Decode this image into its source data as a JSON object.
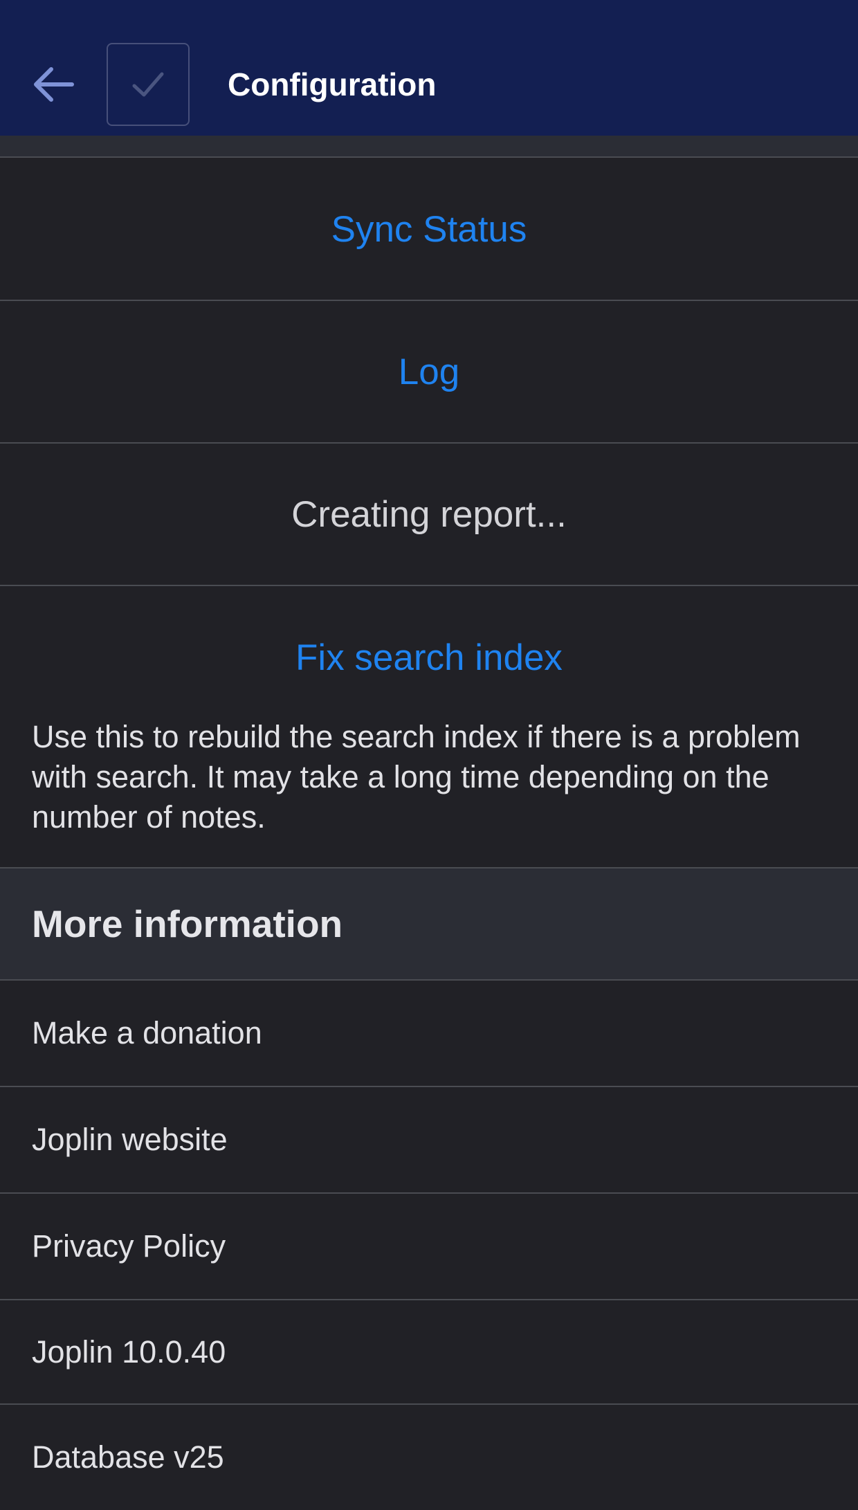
{
  "header": {
    "title": "Configuration",
    "back_icon": "arrow-left-icon",
    "save_icon": "checkmark-icon"
  },
  "advanced": {
    "sync_status_label": "Sync Status",
    "log_label": "Log",
    "report_label": "Creating report...",
    "fix_search_label": "Fix search index",
    "fix_search_description": "Use this to rebuild the search index if there is a problem with search. It may take a long time depending on the number of notes."
  },
  "more_information": {
    "title": "More information",
    "items": [
      {
        "label": "Make a donation"
      },
      {
        "label": "Joplin website"
      },
      {
        "label": "Privacy Policy"
      },
      {
        "label": "Joplin 10.0.40"
      },
      {
        "label": "Database v25"
      }
    ]
  },
  "colors": {
    "header_bg": "#131f52",
    "background": "#212126",
    "section_bg": "#2b2d35",
    "link": "#1f83f0",
    "text": "#e2e2e6"
  }
}
